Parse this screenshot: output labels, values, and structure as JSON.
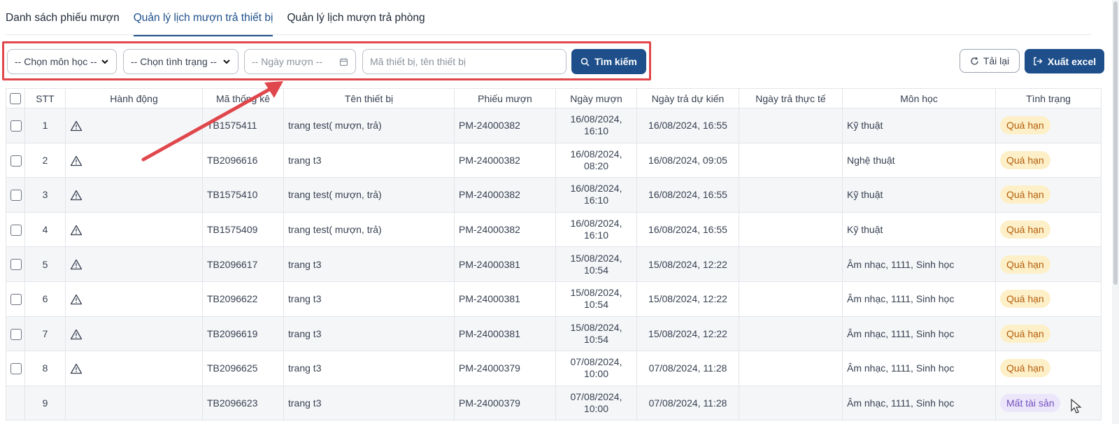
{
  "tabs": [
    {
      "label": "Danh sách phiếu mượn"
    },
    {
      "label": "Quản lý lịch mượn trả thiết bị"
    },
    {
      "label": "Quản lý lịch mượn trả phòng"
    }
  ],
  "filters": {
    "subject_select": "-- Chọn môn học --",
    "status_select": "-- Chọn tình trạng --",
    "date_placeholder": "-- Ngày mượn --",
    "search_placeholder": "Mã thiết bị, tên thiết bị",
    "search_button": "Tìm kiếm"
  },
  "actions": {
    "reload": "Tải lại",
    "export": "Xuất excel"
  },
  "table": {
    "headers": [
      "STT",
      "Hành động",
      "Mã thống kê",
      "Tên thiết bị",
      "Phiếu mượn",
      "Ngày mượn",
      "Ngày trả dự kiến",
      "Ngày trả thực tế",
      "Môn học",
      "Tình trạng"
    ],
    "rows": [
      {
        "stt": "1",
        "code": "TB1575411",
        "name": "trang test( mượn, trả)",
        "slip": "PM-24000382",
        "borrow_date": "16/08/2024,",
        "borrow_time": "16:10",
        "due": "16/08/2024, 16:55",
        "returned": "",
        "subject": "Kỹ thuật",
        "status": "Quá hạn"
      },
      {
        "stt": "2",
        "code": "TB2096616",
        "name": "trang t3",
        "slip": "PM-24000382",
        "borrow_date": "16/08/2024,",
        "borrow_time": "08:20",
        "due": "16/08/2024, 09:05",
        "returned": "",
        "subject": "Nghệ thuật",
        "status": "Quá hạn"
      },
      {
        "stt": "3",
        "code": "TB1575410",
        "name": "trang test( mượn, trả)",
        "slip": "PM-24000382",
        "borrow_date": "16/08/2024,",
        "borrow_time": "16:10",
        "due": "16/08/2024, 16:55",
        "returned": "",
        "subject": "Kỹ thuật",
        "status": "Quá hạn"
      },
      {
        "stt": "4",
        "code": "TB1575409",
        "name": "trang test( mượn, trả)",
        "slip": "PM-24000382",
        "borrow_date": "16/08/2024,",
        "borrow_time": "16:10",
        "due": "16/08/2024, 16:55",
        "returned": "",
        "subject": "Kỹ thuật",
        "status": "Quá hạn"
      },
      {
        "stt": "5",
        "code": "TB2096617",
        "name": "trang t3",
        "slip": "PM-24000381",
        "borrow_date": "15/08/2024,",
        "borrow_time": "10:54",
        "due": "15/08/2024, 12:22",
        "returned": "",
        "subject": "Âm nhạc, 1111, Sinh học",
        "status": "Quá hạn"
      },
      {
        "stt": "6",
        "code": "TB2096622",
        "name": "trang t3",
        "slip": "PM-24000381",
        "borrow_date": "15/08/2024,",
        "borrow_time": "10:54",
        "due": "15/08/2024, 12:22",
        "returned": "",
        "subject": "Âm nhạc, 1111, Sinh học",
        "status": "Quá hạn"
      },
      {
        "stt": "7",
        "code": "TB2096619",
        "name": "trang t3",
        "slip": "PM-24000381",
        "borrow_date": "15/08/2024,",
        "borrow_time": "10:54",
        "due": "15/08/2024, 12:22",
        "returned": "",
        "subject": "Âm nhạc, 1111, Sinh học",
        "status": "Quá hạn"
      },
      {
        "stt": "8",
        "code": "TB2096625",
        "name": "trang t3",
        "slip": "PM-24000379",
        "borrow_date": "07/08/2024,",
        "borrow_time": "10:00",
        "due": "07/08/2024, 11:28",
        "returned": "",
        "subject": "Âm nhạc, 1111, Sinh học",
        "status": "Quá hạn"
      },
      {
        "stt": "9",
        "code": "TB2096623",
        "name": "trang t3",
        "slip": "PM-24000379",
        "borrow_date": "07/08/2024,",
        "borrow_time": "10:00",
        "due": "07/08/2024, 11:28",
        "returned": "",
        "subject": "Âm nhạc, 1111, Sinh học",
        "status": "Mất tài sản"
      }
    ]
  },
  "colors": {
    "primary": "#1e4f8a",
    "overdue_bg": "#fdf0c8",
    "overdue_text": "#b35d0c",
    "lost_bg": "#ece6fa",
    "lost_text": "#7250bf",
    "annotation": "#e0474c"
  },
  "icons": {
    "action": "warning-icon",
    "search": "search-icon",
    "reload": "refresh-icon",
    "export": "export-icon",
    "date": "calendar-icon"
  }
}
